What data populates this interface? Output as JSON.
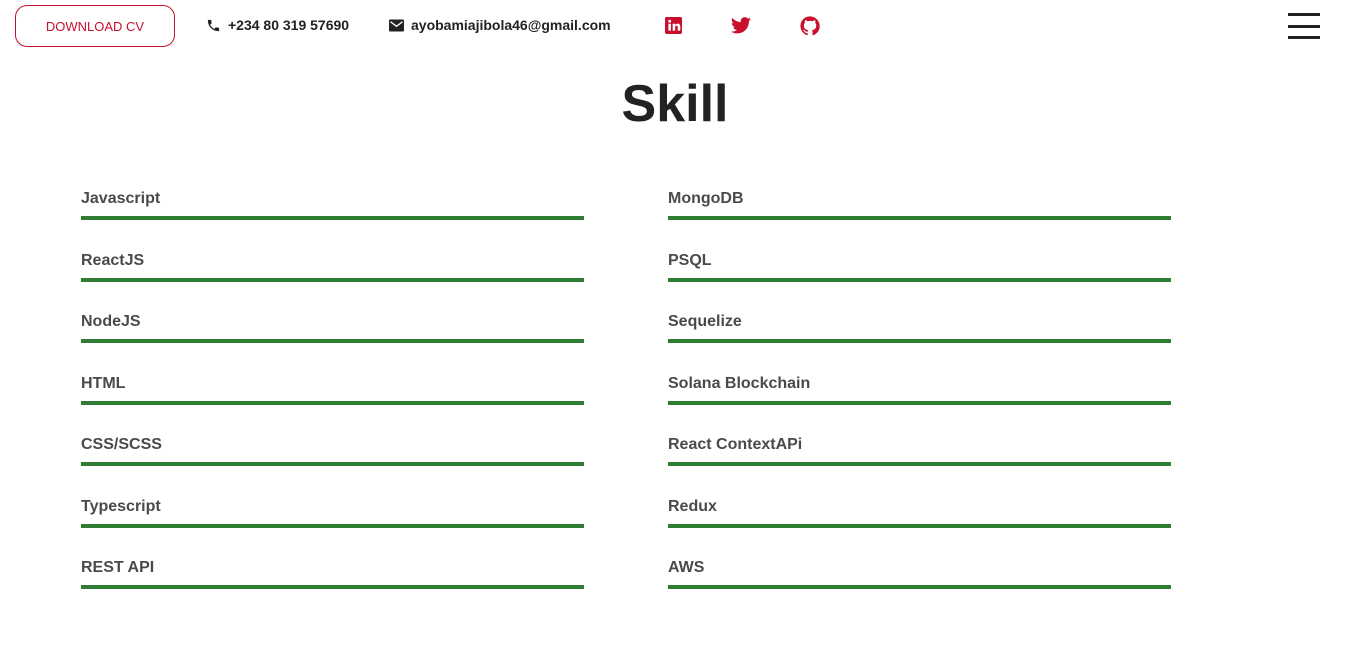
{
  "header": {
    "download_cv": "DOWNLOAD CV",
    "phone": "+234 80 319 57690",
    "email": "ayobamiajibola46@gmail.com",
    "social_icons": [
      "linkedin-icon",
      "twitter-icon",
      "github-icon"
    ],
    "accent_color": "#c8102e"
  },
  "title": "Skill",
  "bar_color": "#2e7d32",
  "skills_left": [
    {
      "name": "Javascript",
      "level": 100
    },
    {
      "name": "ReactJS",
      "level": 100
    },
    {
      "name": "NodeJS",
      "level": 100
    },
    {
      "name": "HTML",
      "level": 100
    },
    {
      "name": "CSS/SCSS",
      "level": 100
    },
    {
      "name": "Typescript",
      "level": 100
    },
    {
      "name": "REST API",
      "level": 100
    }
  ],
  "skills_right": [
    {
      "name": "MongoDB",
      "level": 100
    },
    {
      "name": "PSQL",
      "level": 100
    },
    {
      "name": "Sequelize",
      "level": 100
    },
    {
      "name": "Solana Blockchain",
      "level": 100
    },
    {
      "name": "React ContextAPi",
      "level": 100
    },
    {
      "name": "Redux",
      "level": 100
    },
    {
      "name": "AWS",
      "level": 100
    }
  ]
}
